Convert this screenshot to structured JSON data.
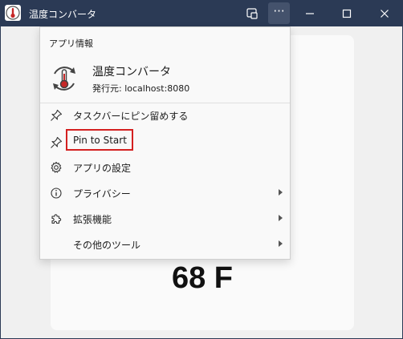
{
  "window": {
    "title": "温度コンバータ",
    "icons": [
      "thermometer-app-icon",
      "screen-cast-icon",
      "more-icon",
      "minimize-icon",
      "maximize-icon",
      "close-icon"
    ]
  },
  "toolbar": {
    "more_label": "···"
  },
  "app": {
    "temperature_display": "68 F"
  },
  "menu": {
    "section_title": "アプリ情報",
    "app_name": "温度コンバータ",
    "publisher": "発行元: localhost:8080",
    "items": [
      {
        "label": "タスクバーにピン留めする",
        "icon": "pin-icon",
        "submenu": false
      },
      {
        "label": "Pin to Start",
        "icon": "pin-icon",
        "submenu": false
      },
      {
        "label": "アプリの設定",
        "icon": "gear-icon",
        "submenu": false
      },
      {
        "label": "プライバシー",
        "icon": "info-icon",
        "submenu": true
      },
      {
        "label": "拡張機能",
        "icon": "puzzle-icon",
        "submenu": true
      },
      {
        "label": "その他のツール",
        "icon": "",
        "submenu": true
      }
    ]
  },
  "colors": {
    "titlebar": "#2b3a55",
    "highlight": "#d42020"
  }
}
